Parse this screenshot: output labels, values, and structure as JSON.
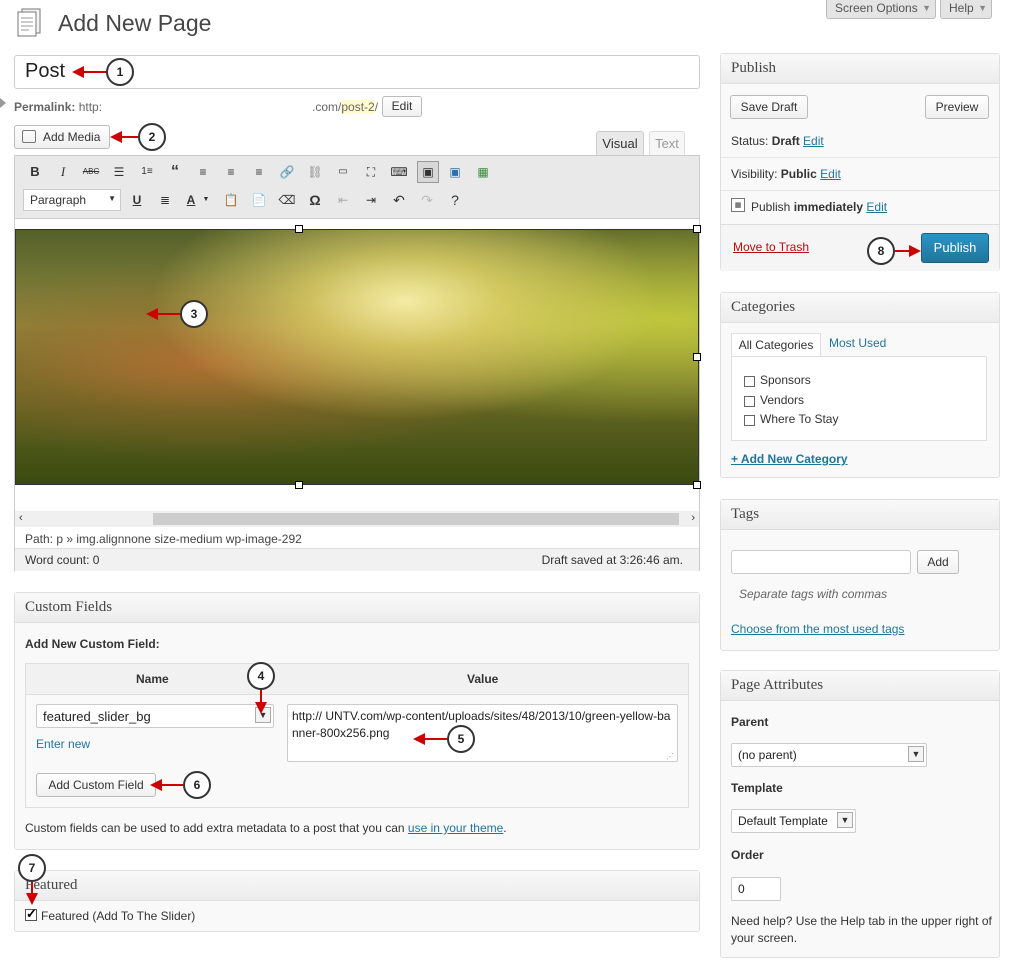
{
  "header": {
    "title": "Add New Page",
    "screen_options": "Screen Options",
    "help": "Help"
  },
  "post": {
    "title": "Post",
    "permalink_label": "Permalink:",
    "permalink_start": "http:",
    "permalink_end": ".com/",
    "permalink_slug": "post-2",
    "permalink_trail": "/",
    "edit_btn": "Edit",
    "add_media": "Add Media",
    "tab_visual": "Visual",
    "tab_text": "Text",
    "format_select": "Paragraph",
    "path": "Path: p » img.alignnone size-medium wp-image-292",
    "word_count": "Word count: 0",
    "draft_saved": "Draft saved at 3:26:46 am."
  },
  "toolbar_icons": [
    "bold-icon",
    "italic-icon",
    "strikethrough-icon",
    "bullet-list-icon",
    "numbered-list-icon",
    "blockquote-icon",
    "align-left-icon",
    "align-center-icon",
    "align-right-icon",
    "link-icon",
    "unlink-icon",
    "more-tag-icon",
    "fullscreen-icon",
    "kitchen-sink-icon",
    "insert-image-icon",
    "slider-icon",
    "video-icon"
  ],
  "custom_fields": {
    "title": "Custom Fields",
    "add_new_label": "Add New Custom Field:",
    "col_name": "Name",
    "col_value": "Value",
    "name_value": "featured_slider_bg",
    "value_text": "http:// UNTV.com/wp-content/uploads/sites/48/2013/10/green-yellow-banner-800x256.png",
    "enter_new": "Enter new",
    "add_button": "Add Custom Field",
    "note_prefix": "Custom fields can be used to add extra metadata to a post that you can ",
    "note_link": "use in your theme",
    "note_suffix": "."
  },
  "featured": {
    "title": "Featured",
    "checkbox_label": "Featured (Add To The Slider)"
  },
  "publish": {
    "title": "Publish",
    "save_draft": "Save Draft",
    "preview": "Preview",
    "status_label": "Status: ",
    "status_value": "Draft",
    "visibility_label": "Visibility: ",
    "visibility_value": "Public",
    "publish_label": "Publish ",
    "publish_value": "immediately",
    "edit": "Edit",
    "trash": "Move to Trash",
    "publish_btn": "Publish"
  },
  "categories": {
    "title": "Categories",
    "tab_all": "All Categories",
    "tab_used": "Most Used",
    "items": [
      "Sponsors",
      "Vendors",
      "Where To Stay"
    ],
    "add_new": "+ Add New Category"
  },
  "tags": {
    "title": "Tags",
    "add": "Add",
    "hint": "Separate tags with commas",
    "choose": "Choose from the most used tags"
  },
  "page_attributes": {
    "title": "Page Attributes",
    "parent_label": "Parent",
    "parent_value": "(no parent)",
    "template_label": "Template",
    "template_value": "Default Template",
    "order_label": "Order",
    "order_value": "0",
    "help": "Need help? Use the Help tab in the upper right of your screen."
  },
  "callouts": [
    "1",
    "2",
    "3",
    "4",
    "5",
    "6",
    "7",
    "8"
  ],
  "colors": {
    "accent": "#21759b",
    "arrow": "#cc0000",
    "trash": "#bc0b0b"
  }
}
